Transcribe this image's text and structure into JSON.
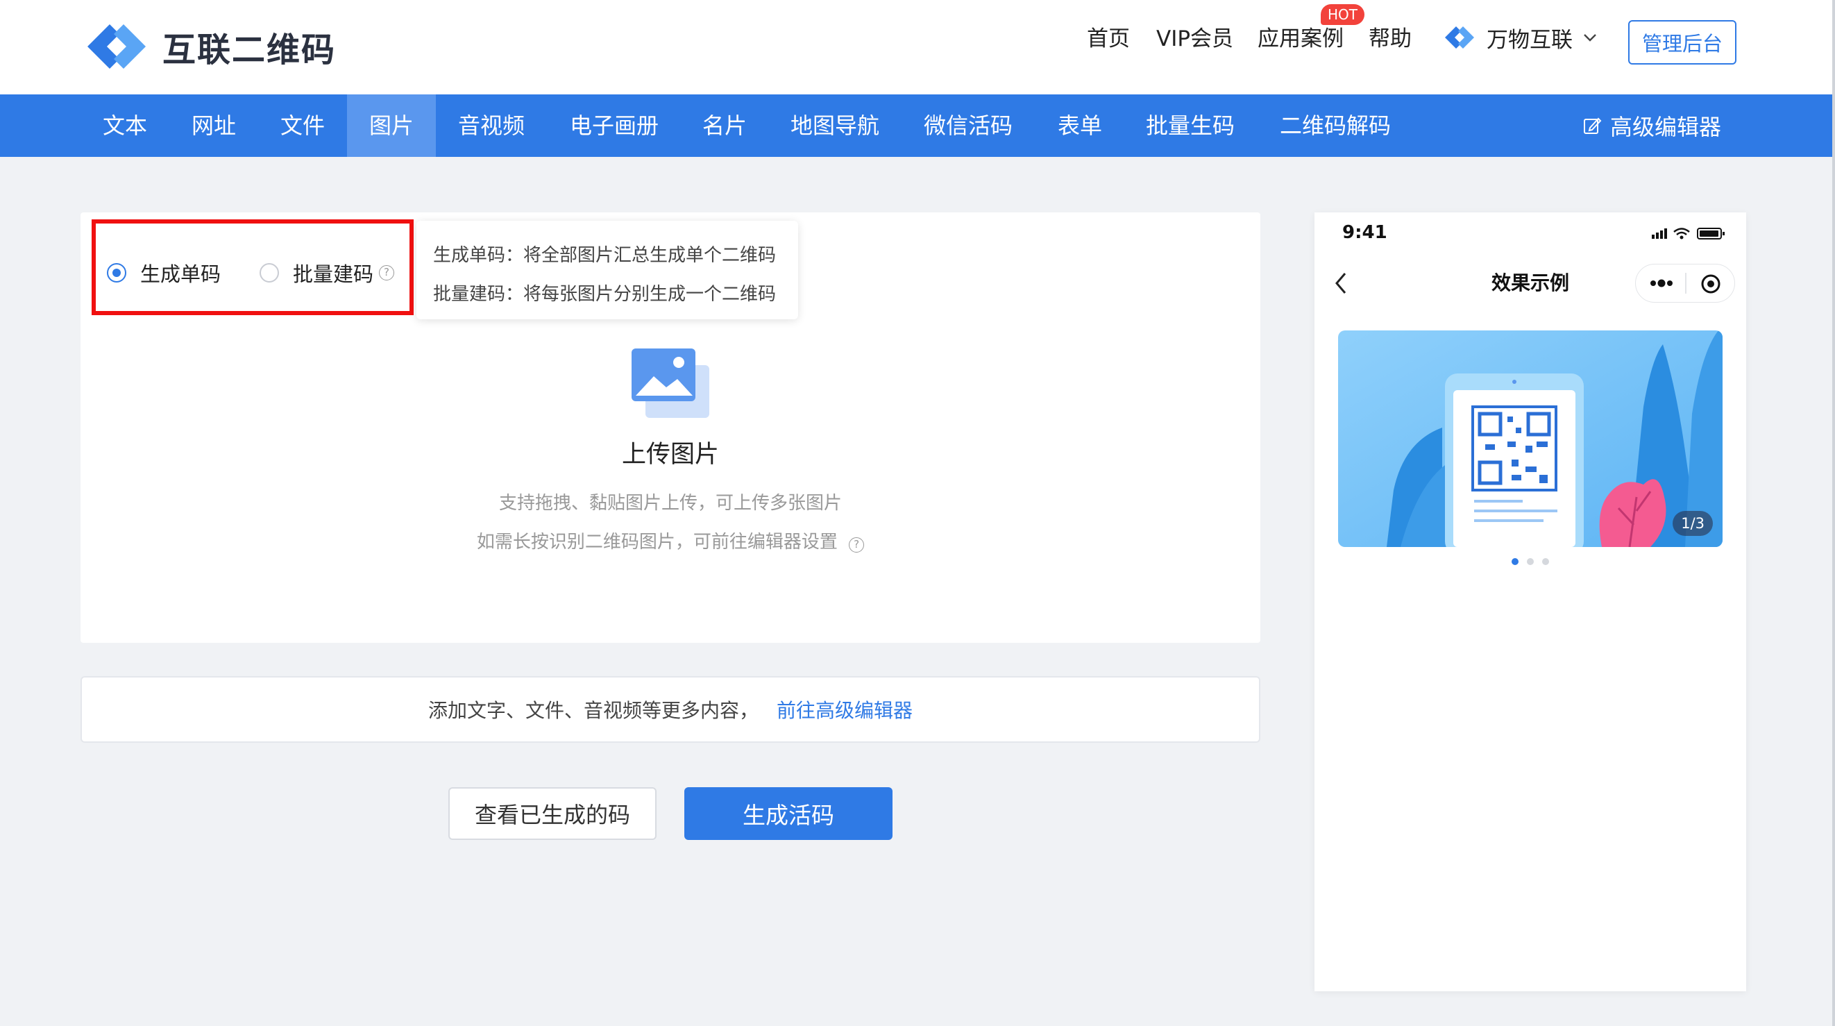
{
  "brand": {
    "name": "互联二维码"
  },
  "topnav": {
    "home": "首页",
    "vip": "VIP会员",
    "cases": "应用案例",
    "hot": "HOT",
    "help": "帮助",
    "org": "万物互联",
    "admin": "管理后台"
  },
  "tabs": [
    {
      "label": "文本"
    },
    {
      "label": "网址"
    },
    {
      "label": "文件"
    },
    {
      "label": "图片"
    },
    {
      "label": "音视频"
    },
    {
      "label": "电子画册"
    },
    {
      "label": "名片"
    },
    {
      "label": "地图导航"
    },
    {
      "label": "微信活码"
    },
    {
      "label": "表单"
    },
    {
      "label": "批量生码"
    },
    {
      "label": "二维码解码"
    }
  ],
  "active_tab": "图片",
  "advanced_editor": "高级编辑器",
  "mode": {
    "single": "生成单码",
    "batch": "批量建码",
    "selected": "single",
    "help_icon": "question-circle-icon"
  },
  "tooltip": {
    "line1": "生成单码：将全部图片汇总生成单个二维码",
    "line2": "批量建码：将每张图片分别生成一个二维码"
  },
  "upload": {
    "title": "上传图片",
    "hint1": "支持拖拽、黏贴图片上传，可上传多张图片",
    "hint2": "如需长按识别二维码图片，可前往编辑器设置"
  },
  "more": {
    "text": "添加文字、文件、音视频等更多内容，",
    "link": "前往高级编辑器"
  },
  "buttons": {
    "view": "查看已生成的码",
    "generate": "生成活码"
  },
  "phone": {
    "time": "9:41",
    "title": "效果示例",
    "counter": "1/3",
    "slides_total": 3,
    "slide_active": 1
  },
  "colors": {
    "primary": "#2f7ae5",
    "highlight_box": "#f01010",
    "hot_badge": "#f2423b"
  }
}
